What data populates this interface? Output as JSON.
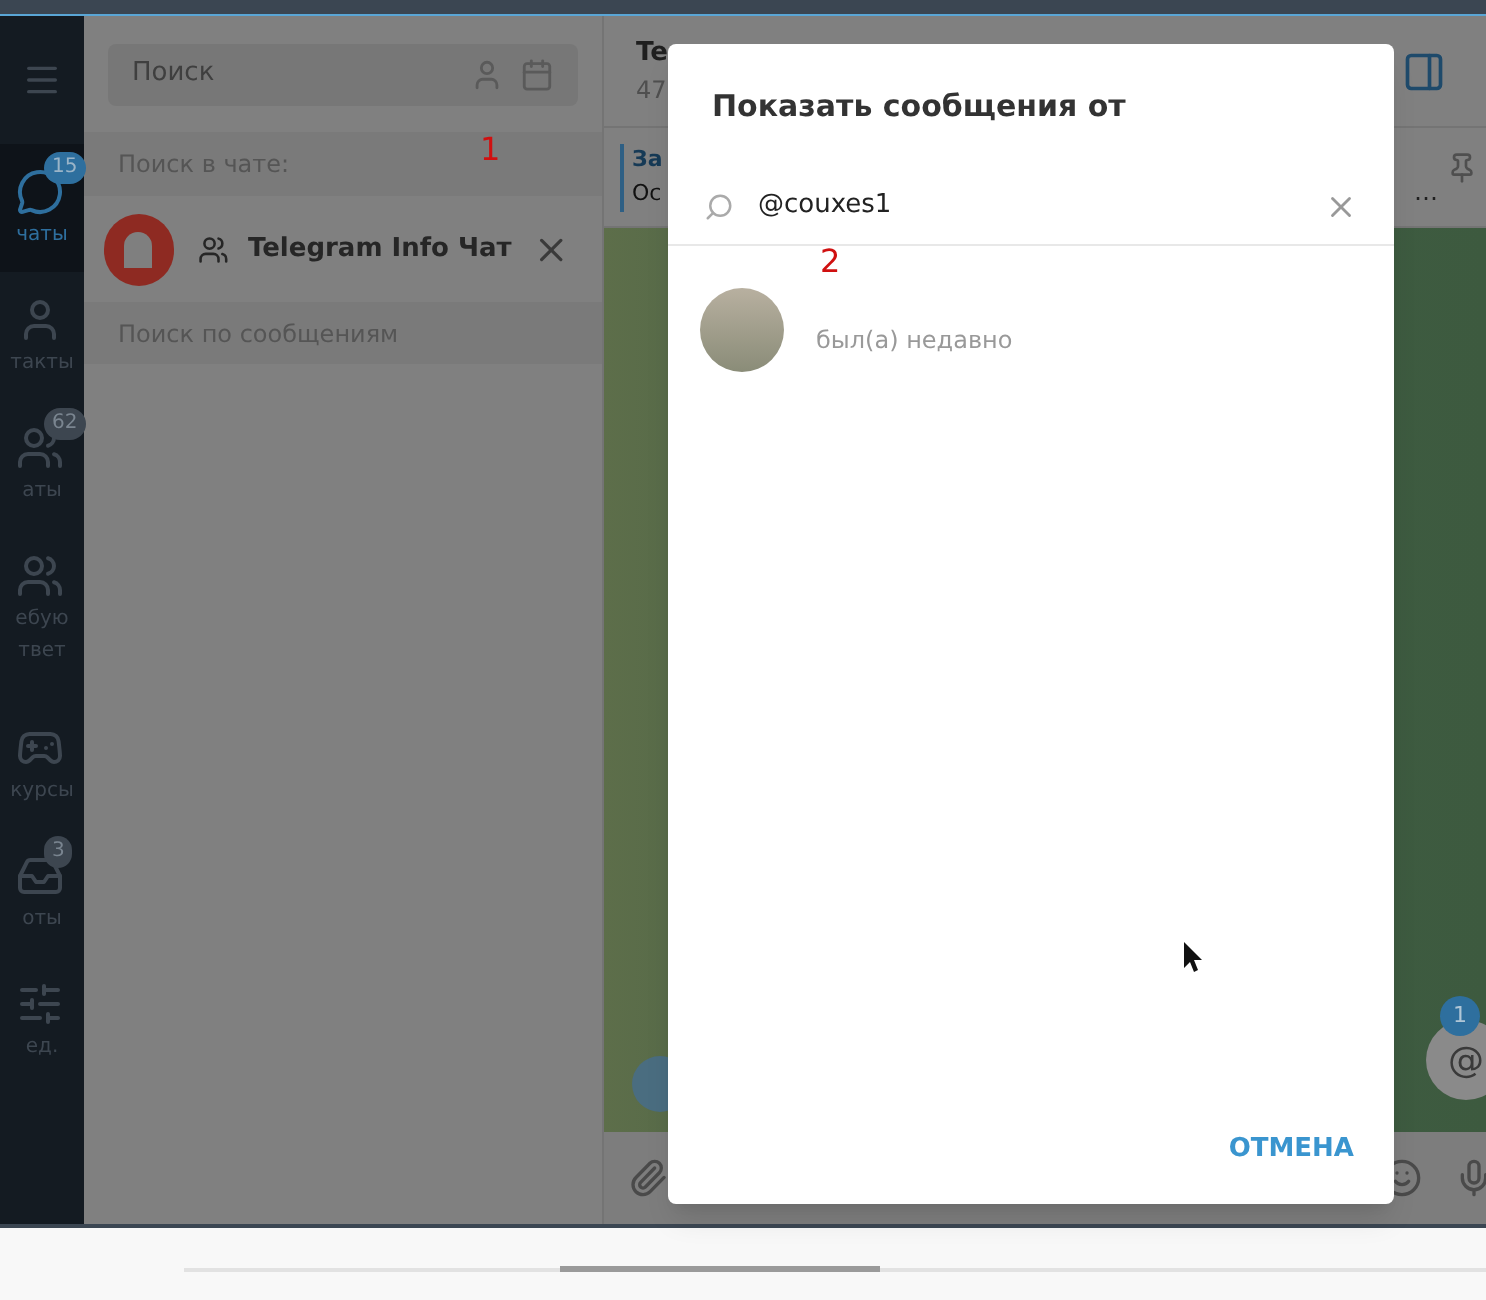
{
  "sidebar": {
    "items": [
      {
        "kind": "chats",
        "labels": [
          "чаты"
        ],
        "badge": "15",
        "selected": true
      },
      {
        "kind": "contacts",
        "labels": [
          "такты"
        ],
        "selected": false
      },
      {
        "kind": "groups",
        "labels": [
          "аты"
        ],
        "badge": "62",
        "selected": false
      },
      {
        "kind": "groups",
        "labels": [
          "ебую",
          "твет"
        ],
        "selected": false
      },
      {
        "kind": "game",
        "labels": [
          "курсы"
        ],
        "selected": false
      },
      {
        "kind": "bots",
        "labels": [
          "оты"
        ],
        "badge": "3",
        "selected": false
      },
      {
        "kind": "edit",
        "labels": [
          "ед."
        ],
        "selected": false
      }
    ]
  },
  "chat_list": {
    "search": {
      "placeholder": "Поиск"
    },
    "search_in_chat_label": "Поиск в чате:",
    "chat": {
      "name": "Telegram Info Чат"
    },
    "message_search": {
      "placeholder": "Поиск по сообщениям"
    }
  },
  "chat_header": {
    "title": "Te",
    "subtitle": "47"
  },
  "pinned": {
    "title": "За",
    "text": "Ос",
    "more": "…"
  },
  "mention_badge": "1",
  "mention_symbol": "@",
  "dialog": {
    "title": "Показать сообщения от",
    "search": {
      "value": "@couxes1"
    },
    "members": [
      {
        "status": "был(а) недавно"
      }
    ],
    "cancel": "ОТМЕНА"
  },
  "annotations": [
    "1",
    "2"
  ]
}
